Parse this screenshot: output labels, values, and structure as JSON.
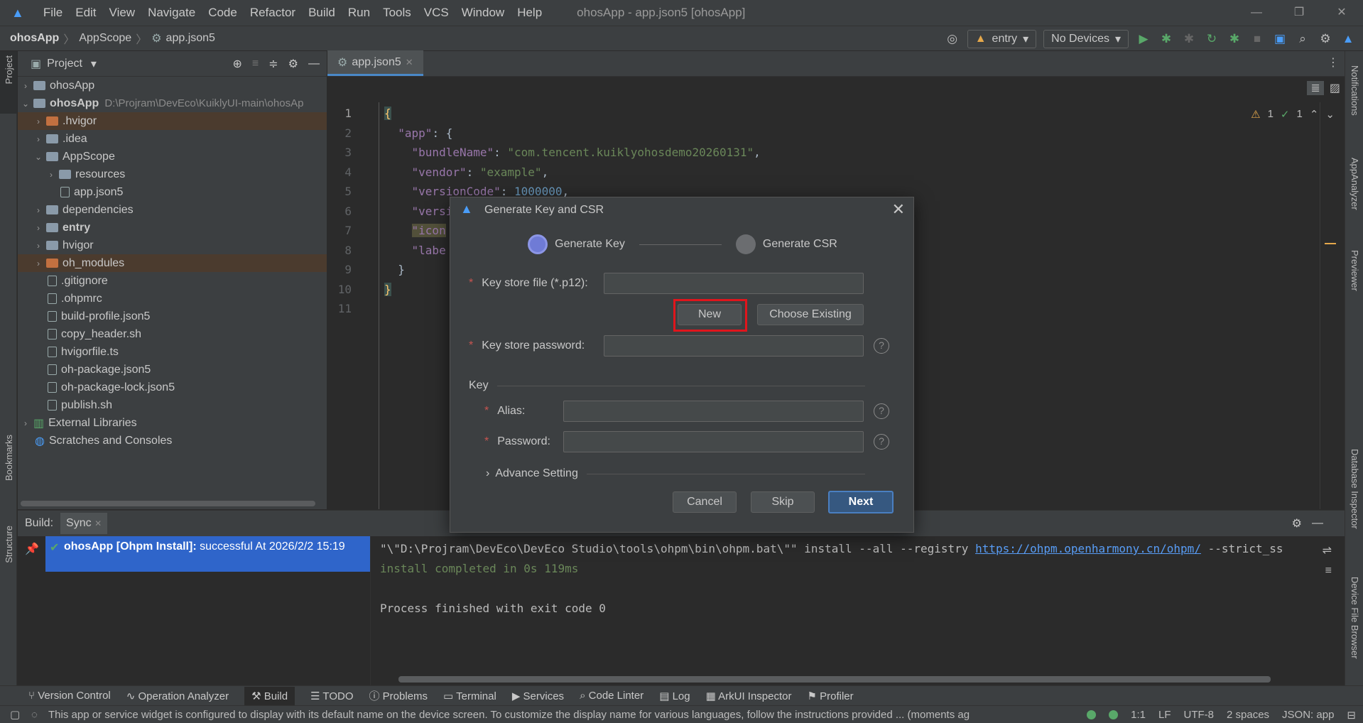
{
  "titlebar": {
    "menu": [
      "File",
      "Edit",
      "View",
      "Navigate",
      "Code",
      "Refactor",
      "Build",
      "Run",
      "Tools",
      "VCS",
      "Window",
      "Help"
    ],
    "title": "ohosApp - app.json5 [ohosApp]"
  },
  "navbar": {
    "crumbs": [
      "ohosApp",
      "AppScope",
      "app.json5"
    ],
    "run_config": "entry",
    "device": "No Devices"
  },
  "left_stripe": {
    "project": "Project",
    "bookmarks": "Bookmarks",
    "structure": "Structure"
  },
  "right_stripe": {
    "notifications": "Notifications",
    "appanalyzer": "AppAnalyzer",
    "previewer": "Previewer",
    "database": "Database Inspector",
    "device_file": "Device File Browser"
  },
  "project": {
    "title": "Project",
    "root1": "ohosApp",
    "root2": "ohosApp",
    "root2_path": "D:\\Projram\\DevEco\\KuiklyUI-main\\ohosAp",
    "items": [
      ".hvigor",
      ".idea",
      "AppScope",
      "resources",
      "app.json5",
      "dependencies",
      "entry",
      "hvigor",
      "oh_modules",
      ".gitignore",
      ".ohpmrc",
      "build-profile.json5",
      "copy_header.sh",
      "hvigorfile.ts",
      "oh-package.json5",
      "oh-package-lock.json5",
      "publish.sh",
      "External Libraries",
      "Scratches and Consoles"
    ]
  },
  "editor": {
    "tab": "app.json5",
    "lines": [
      "1",
      "2",
      "3",
      "4",
      "5",
      "6",
      "7",
      "8",
      "9",
      "10",
      "11"
    ],
    "code": {
      "l1": "{",
      "l2k": "\"app\"",
      "l2r": ": {",
      "l3k": "\"bundleName\"",
      "l3v": "\"com.tencent.kuiklyohosdemo20260131\"",
      "l4k": "\"vendor\"",
      "l4v": "\"example\"",
      "l5k": "\"versionCode\"",
      "l5v": "1000000",
      "l6k": "\"versi",
      "l7k": "\"icon",
      "l8k": "\"labe",
      "l9": "}",
      "l10": "}"
    },
    "inspections": {
      "warnings": "1",
      "ok": "1"
    }
  },
  "build": {
    "label": "Build:",
    "tab": "Sync",
    "task_bold": "ohosApp [Ohpm Install]:",
    "task_status": "successful At 2026/2/2 15:19",
    "out1_a": "\"\\\"D:\\Projram\\DevEco\\DevEco Studio\\tools\\ohpm\\bin\\ohpm.bat\\\"\" install --all --registry ",
    "out1_link": "https://ohpm.openharmony.cn/ohpm/",
    "out1_b": " --strict_ss",
    "out2": "install completed in 0s 119ms",
    "out3": "Process finished with exit code 0"
  },
  "tooltabs": [
    "Version Control",
    "Operation Analyzer",
    "Build",
    "TODO",
    "Problems",
    "Terminal",
    "Services",
    "Code Linter",
    "Log",
    "ArkUI Inspector",
    "Profiler"
  ],
  "status": {
    "message": "This app or service widget is configured to display with its default name on the device screen. To customize the display name for various languages, follow the instructions provided ... (moments ag",
    "pos": "1:1",
    "eol": "LF",
    "enc": "UTF-8",
    "indent": "2 spaces",
    "schema": "JSON: app"
  },
  "dialog": {
    "title": "Generate Key and CSR",
    "step1": "Generate Key",
    "step2": "Generate CSR",
    "keystore_label": "Key store file (*.p12):",
    "new_btn": "New",
    "choose_btn": "Choose Existing",
    "password_label": "Key store password:",
    "key_section": "Key",
    "alias_label": "Alias:",
    "key_password_label": "Password:",
    "advance": "Advance Setting",
    "cancel": "Cancel",
    "skip": "Skip",
    "next": "Next",
    "required": "*"
  },
  "colors": {
    "accent": "#4a88c7",
    "highlight_box": "#e0151c",
    "primary_button": "#365880"
  }
}
